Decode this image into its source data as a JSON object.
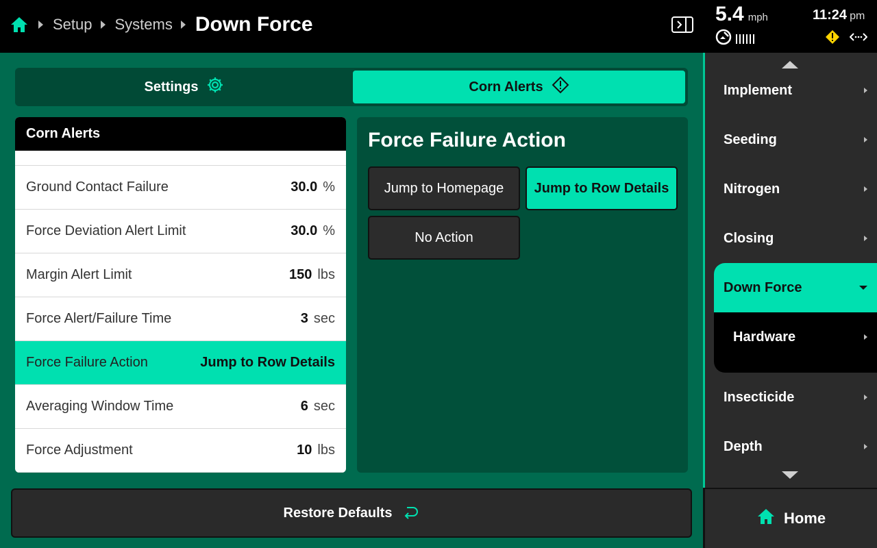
{
  "breadcrumb": {
    "items": [
      "Setup",
      "Systems"
    ],
    "current": "Down Force"
  },
  "status": {
    "speed": "5.4",
    "speed_unit": "mph",
    "time": "11:24",
    "ampm": "pm"
  },
  "tabs": {
    "settings_label": "Settings",
    "alerts_label": "Corn Alerts",
    "active": "Corn Alerts"
  },
  "list": {
    "header": "Corn Alerts",
    "rows": [
      {
        "label": "Ground Contact Failure",
        "value": "30.0",
        "unit": "%"
      },
      {
        "label": "Force Deviation Alert Limit",
        "value": "30.0",
        "unit": "%"
      },
      {
        "label": "Margin Alert Limit",
        "value": "150",
        "unit": "lbs"
      },
      {
        "label": "Force Alert/Failure Time",
        "value": "3",
        "unit": "sec"
      },
      {
        "label": "Force Failure Action",
        "value": "Jump to Row Details",
        "unit": ""
      },
      {
        "label": "Averaging Window Time",
        "value": "6",
        "unit": "sec"
      },
      {
        "label": "Force Adjustment",
        "value": "10",
        "unit": "lbs"
      }
    ]
  },
  "detail": {
    "title": "Force Failure Action",
    "options": [
      "Jump to Homepage",
      "Jump to Row Details",
      "No Action"
    ],
    "selected": "Jump to Row Details"
  },
  "restore_label": "Restore Defaults",
  "sidebar": {
    "items": [
      "Implement",
      "Seeding",
      "Nitrogen",
      "Closing"
    ],
    "active": "Down Force",
    "sub_item": "Hardware",
    "items_after": [
      "Insecticide",
      "Depth"
    ]
  },
  "home_label": "Home",
  "colors": {
    "accent": "#00E0B0",
    "background_green": "#006B4F",
    "panel_green": "#01503A",
    "warning": "#FFD400"
  }
}
